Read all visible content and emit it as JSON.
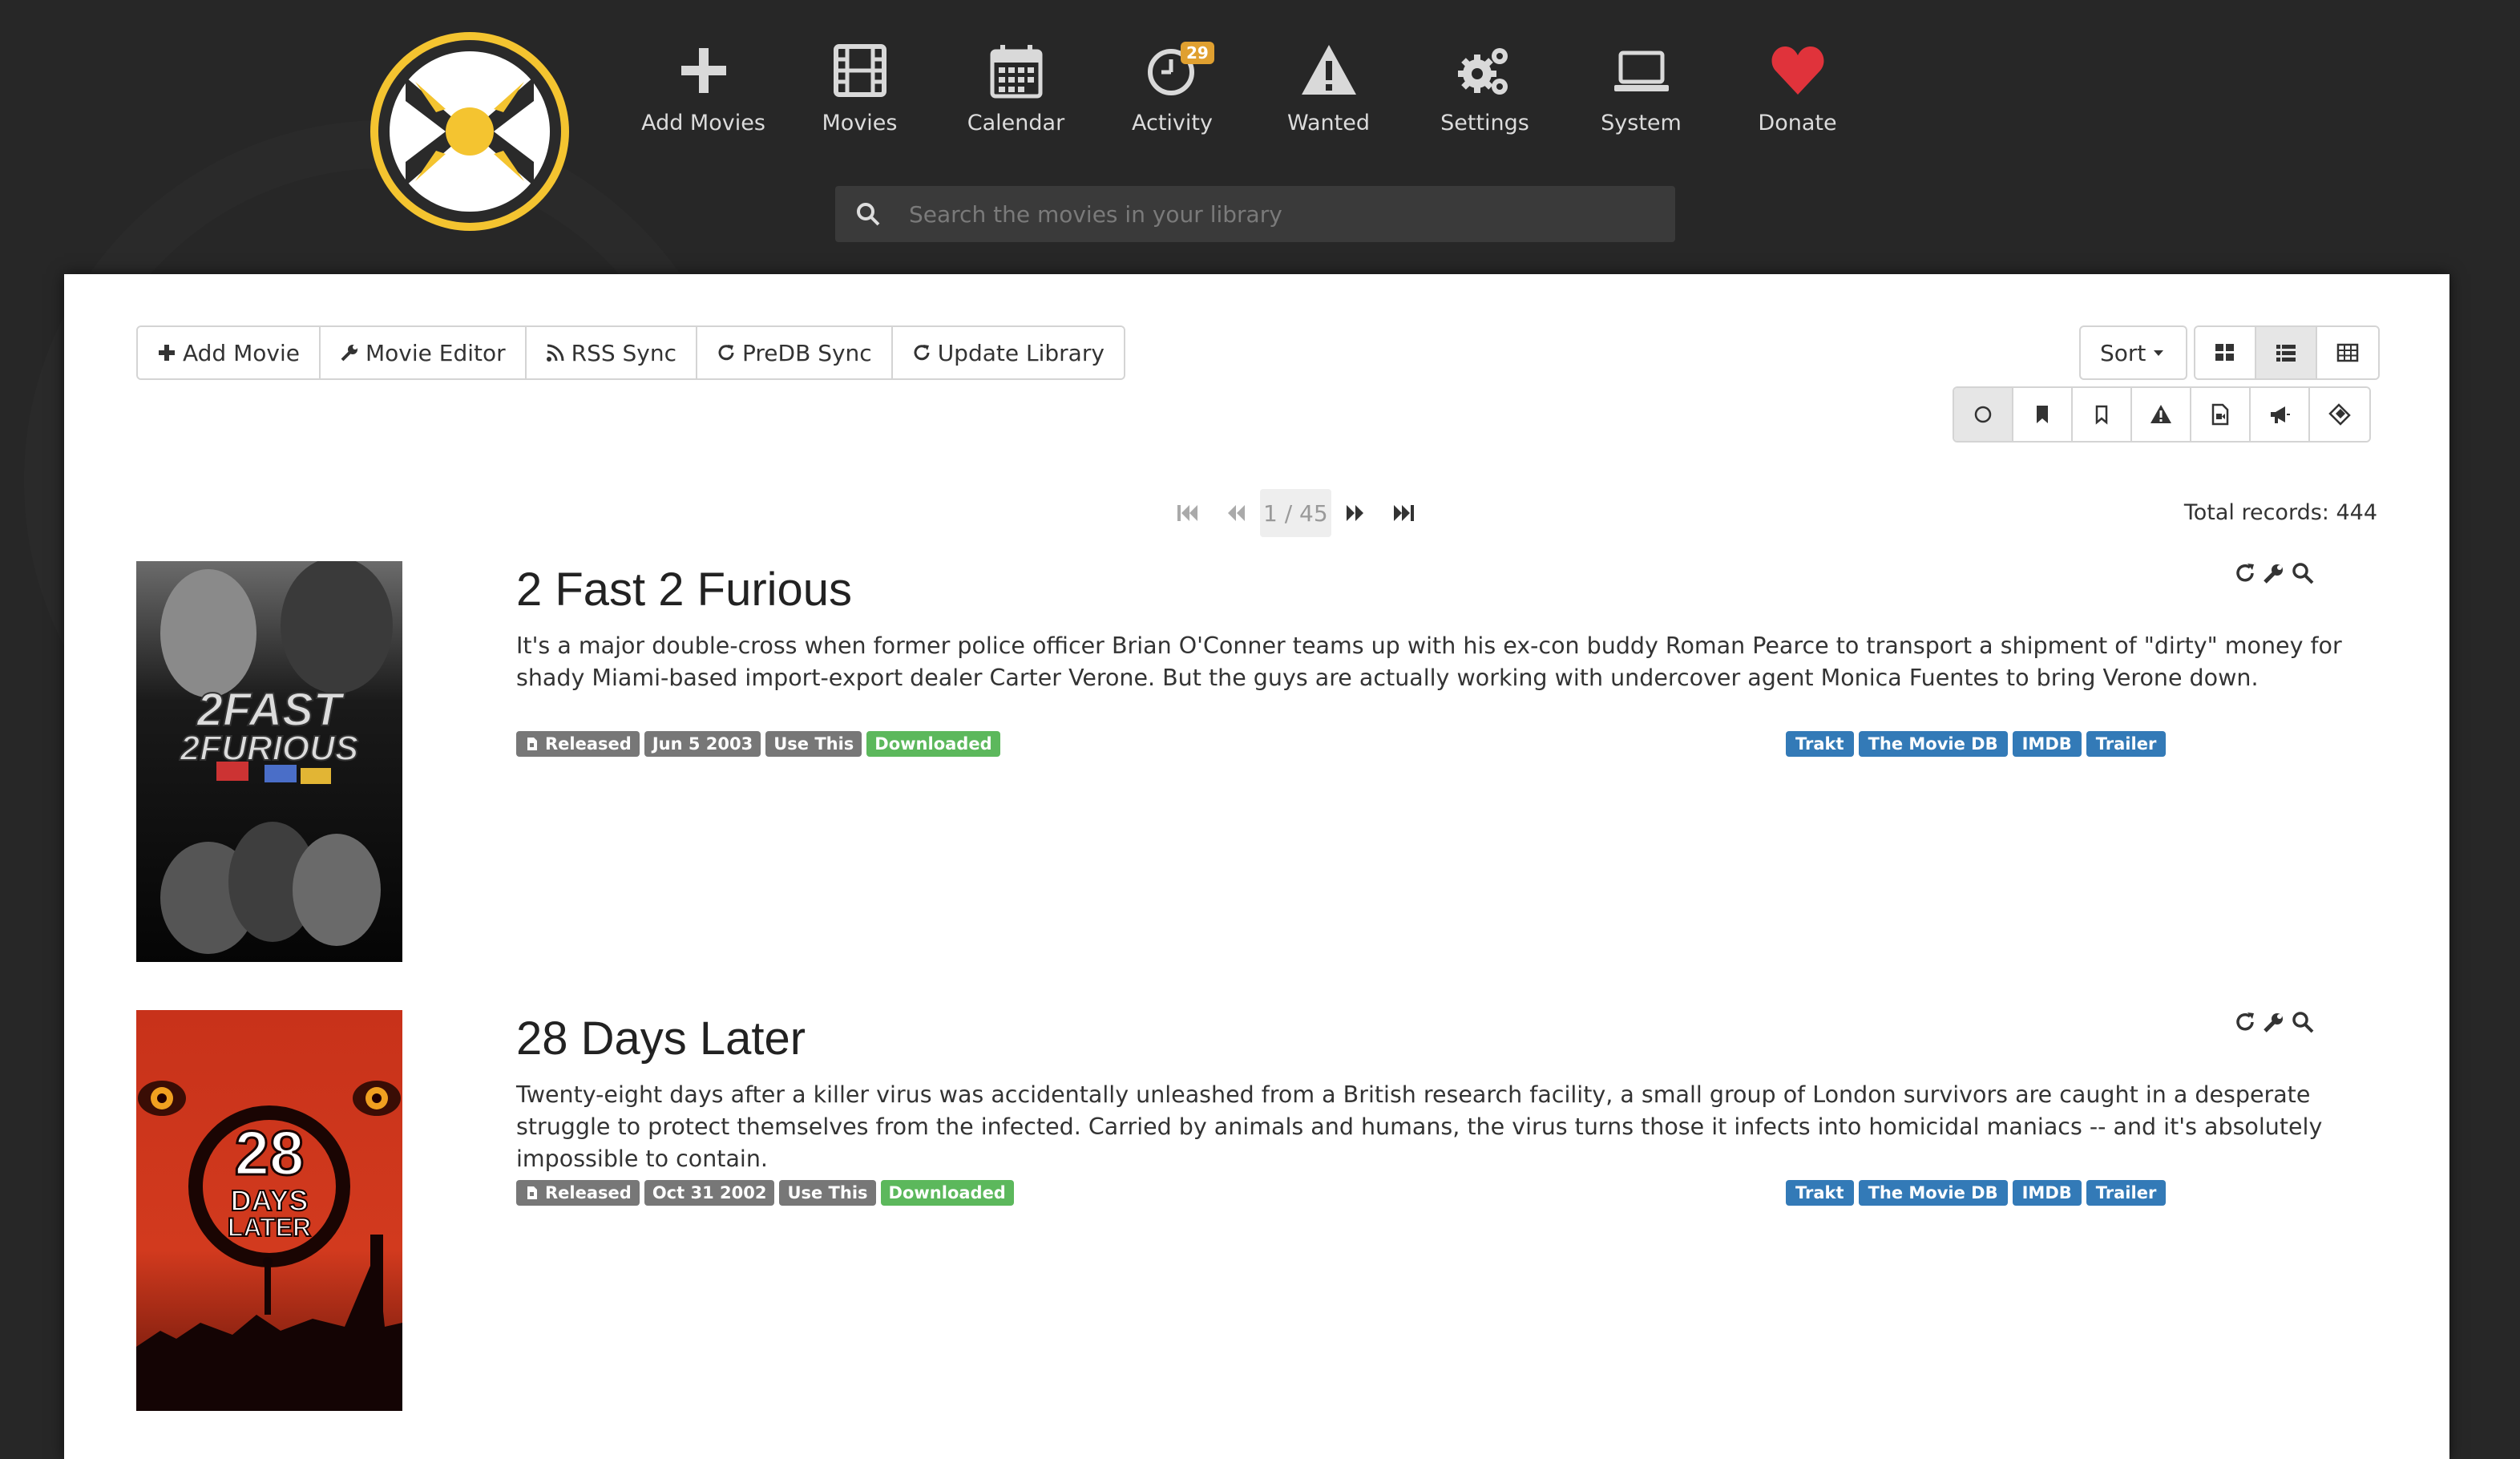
{
  "nav": {
    "items": [
      {
        "label": "Add Movies",
        "icon": "plus-icon"
      },
      {
        "label": "Movies",
        "icon": "film-icon"
      },
      {
        "label": "Calendar",
        "icon": "calendar-icon"
      },
      {
        "label": "Activity",
        "icon": "clock-icon",
        "badge": "29"
      },
      {
        "label": "Wanted",
        "icon": "warning-icon"
      },
      {
        "label": "Settings",
        "icon": "gears-icon"
      },
      {
        "label": "System",
        "icon": "laptop-icon"
      },
      {
        "label": "Donate",
        "icon": "heart-icon"
      }
    ]
  },
  "search": {
    "placeholder": "Search the movies in your library"
  },
  "toolbar": {
    "add_movie": "Add Movie",
    "movie_editor": "Movie Editor",
    "rss_sync": "RSS Sync",
    "predb_sync": "PreDB Sync",
    "update_library": "Update Library"
  },
  "view": {
    "sort_label": "Sort",
    "active_view": "overview"
  },
  "pager": {
    "text": "1 / 45",
    "total": "Total records: 444"
  },
  "movies": [
    {
      "title": "2 Fast 2 Furious",
      "overview": "It's a major double-cross when former police officer Brian O'Conner teams up with his ex-con buddy Roman Pearce to transport a shipment of \"dirty\" money for shady Miami-based import-export dealer Carter Verone. But the guys are actually working with undercover agent Monica Fuentes to bring Verone down.",
      "status": "Released",
      "date": "Jun 5 2003",
      "profile": "Use This",
      "file_status": "Downloaded",
      "links": [
        "Trakt",
        "The Movie DB",
        "IMDB",
        "Trailer"
      ],
      "poster_text": [
        "2FAST",
        "2FURIOUS"
      ]
    },
    {
      "title": "28 Days Later",
      "overview": "Twenty-eight days after a killer virus was accidentally unleashed from a British research facility, a small group of London survivors are caught in a desperate struggle to protect themselves from the infected. Carried by animals and humans, the virus turns those it infects into homicidal maniacs -- and it's absolutely impossible to contain.",
      "status": "Released",
      "date": "Oct 31 2002",
      "profile": "Use This",
      "file_status": "Downloaded",
      "links": [
        "Trakt",
        "The Movie DB",
        "IMDB",
        "Trailer"
      ],
      "poster_text": [
        "28",
        "DAYS",
        "LATER"
      ]
    }
  ],
  "colors": {
    "header_bg": "#272727",
    "logo_yellow": "#f4c430",
    "badge_gray": "#777777",
    "badge_green": "#5cb85c",
    "link_blue": "#337ab7",
    "donate_red": "#e0333b"
  }
}
